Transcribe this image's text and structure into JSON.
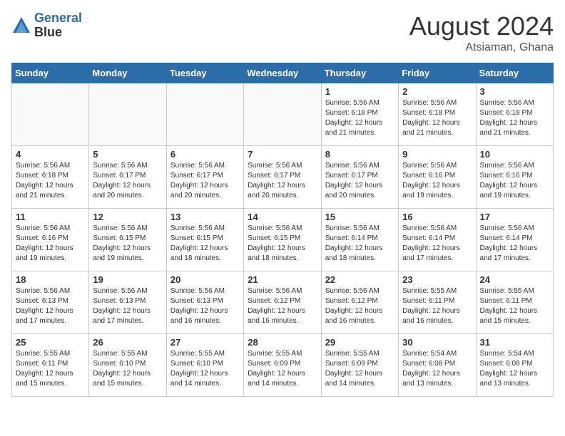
{
  "header": {
    "logo_line1": "General",
    "logo_line2": "Blue",
    "month_year": "August 2024",
    "location": "Atsiaman, Ghana"
  },
  "days_of_week": [
    "Sunday",
    "Monday",
    "Tuesday",
    "Wednesday",
    "Thursday",
    "Friday",
    "Saturday"
  ],
  "weeks": [
    [
      {
        "num": "",
        "info": ""
      },
      {
        "num": "",
        "info": ""
      },
      {
        "num": "",
        "info": ""
      },
      {
        "num": "",
        "info": ""
      },
      {
        "num": "1",
        "info": "Sunrise: 5:56 AM\nSunset: 6:18 PM\nDaylight: 12 hours\nand 21 minutes."
      },
      {
        "num": "2",
        "info": "Sunrise: 5:56 AM\nSunset: 6:18 PM\nDaylight: 12 hours\nand 21 minutes."
      },
      {
        "num": "3",
        "info": "Sunrise: 5:56 AM\nSunset: 6:18 PM\nDaylight: 12 hours\nand 21 minutes."
      }
    ],
    [
      {
        "num": "4",
        "info": "Sunrise: 5:56 AM\nSunset: 6:18 PM\nDaylight: 12 hours\nand 21 minutes."
      },
      {
        "num": "5",
        "info": "Sunrise: 5:56 AM\nSunset: 6:17 PM\nDaylight: 12 hours\nand 20 minutes."
      },
      {
        "num": "6",
        "info": "Sunrise: 5:56 AM\nSunset: 6:17 PM\nDaylight: 12 hours\nand 20 minutes."
      },
      {
        "num": "7",
        "info": "Sunrise: 5:56 AM\nSunset: 6:17 PM\nDaylight: 12 hours\nand 20 minutes."
      },
      {
        "num": "8",
        "info": "Sunrise: 5:56 AM\nSunset: 6:17 PM\nDaylight: 12 hours\nand 20 minutes."
      },
      {
        "num": "9",
        "info": "Sunrise: 5:56 AM\nSunset: 6:16 PM\nDaylight: 12 hours\nand 19 minutes."
      },
      {
        "num": "10",
        "info": "Sunrise: 5:56 AM\nSunset: 6:16 PM\nDaylight: 12 hours\nand 19 minutes."
      }
    ],
    [
      {
        "num": "11",
        "info": "Sunrise: 5:56 AM\nSunset: 6:16 PM\nDaylight: 12 hours\nand 19 minutes."
      },
      {
        "num": "12",
        "info": "Sunrise: 5:56 AM\nSunset: 6:15 PM\nDaylight: 12 hours\nand 19 minutes."
      },
      {
        "num": "13",
        "info": "Sunrise: 5:56 AM\nSunset: 6:15 PM\nDaylight: 12 hours\nand 18 minutes."
      },
      {
        "num": "14",
        "info": "Sunrise: 5:56 AM\nSunset: 6:15 PM\nDaylight: 12 hours\nand 18 minutes."
      },
      {
        "num": "15",
        "info": "Sunrise: 5:56 AM\nSunset: 6:14 PM\nDaylight: 12 hours\nand 18 minutes."
      },
      {
        "num": "16",
        "info": "Sunrise: 5:56 AM\nSunset: 6:14 PM\nDaylight: 12 hours\nand 17 minutes."
      },
      {
        "num": "17",
        "info": "Sunrise: 5:56 AM\nSunset: 6:14 PM\nDaylight: 12 hours\nand 17 minutes."
      }
    ],
    [
      {
        "num": "18",
        "info": "Sunrise: 5:56 AM\nSunset: 6:13 PM\nDaylight: 12 hours\nand 17 minutes."
      },
      {
        "num": "19",
        "info": "Sunrise: 5:56 AM\nSunset: 6:13 PM\nDaylight: 12 hours\nand 17 minutes."
      },
      {
        "num": "20",
        "info": "Sunrise: 5:56 AM\nSunset: 6:13 PM\nDaylight: 12 hours\nand 16 minutes."
      },
      {
        "num": "21",
        "info": "Sunrise: 5:56 AM\nSunset: 6:12 PM\nDaylight: 12 hours\nand 16 minutes."
      },
      {
        "num": "22",
        "info": "Sunrise: 5:56 AM\nSunset: 6:12 PM\nDaylight: 12 hours\nand 16 minutes."
      },
      {
        "num": "23",
        "info": "Sunrise: 5:55 AM\nSunset: 6:11 PM\nDaylight: 12 hours\nand 16 minutes."
      },
      {
        "num": "24",
        "info": "Sunrise: 5:55 AM\nSunset: 6:11 PM\nDaylight: 12 hours\nand 15 minutes."
      }
    ],
    [
      {
        "num": "25",
        "info": "Sunrise: 5:55 AM\nSunset: 6:11 PM\nDaylight: 12 hours\nand 15 minutes."
      },
      {
        "num": "26",
        "info": "Sunrise: 5:55 AM\nSunset: 6:10 PM\nDaylight: 12 hours\nand 15 minutes."
      },
      {
        "num": "27",
        "info": "Sunrise: 5:55 AM\nSunset: 6:10 PM\nDaylight: 12 hours\nand 14 minutes."
      },
      {
        "num": "28",
        "info": "Sunrise: 5:55 AM\nSunset: 6:09 PM\nDaylight: 12 hours\nand 14 minutes."
      },
      {
        "num": "29",
        "info": "Sunrise: 5:55 AM\nSunset: 6:09 PM\nDaylight: 12 hours\nand 14 minutes."
      },
      {
        "num": "30",
        "info": "Sunrise: 5:54 AM\nSunset: 6:08 PM\nDaylight: 12 hours\nand 13 minutes."
      },
      {
        "num": "31",
        "info": "Sunrise: 5:54 AM\nSunset: 6:08 PM\nDaylight: 12 hours\nand 13 minutes."
      }
    ]
  ]
}
